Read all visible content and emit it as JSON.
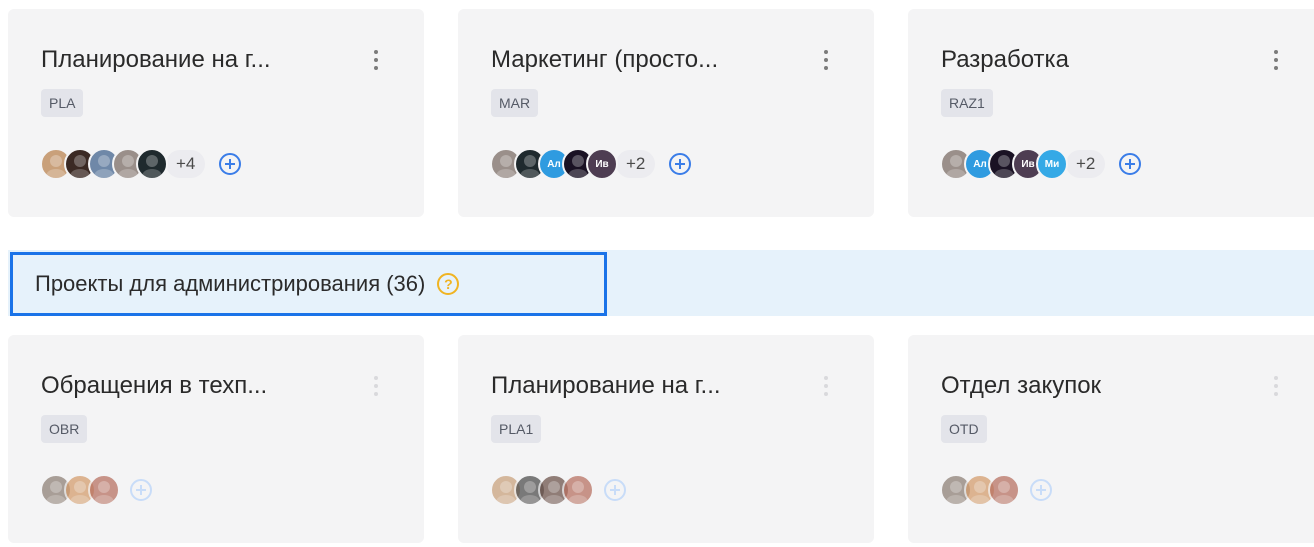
{
  "projects_top": [
    {
      "title": "Планирование на г...",
      "key": "PLA",
      "avatars": [
        {
          "initials": "",
          "color": "#c9a07a",
          "icon": "person-photo"
        },
        {
          "initials": "",
          "color": "#3b2a24",
          "icon": "person-photo"
        },
        {
          "initials": "",
          "color": "#6f88a8",
          "icon": "person-photo"
        },
        {
          "initials": "",
          "color": "#9a8f8a",
          "icon": "person-photo"
        },
        {
          "initials": "",
          "color": "#1f2a2e",
          "icon": "person-photo"
        }
      ],
      "more": "+4"
    },
    {
      "title": "Маркетинг (просто...",
      "key": "MAR",
      "avatars": [
        {
          "initials": "",
          "color": "#9a8f8a",
          "icon": "person-photo"
        },
        {
          "initials": "",
          "color": "#1f2a2e",
          "icon": "person-photo"
        },
        {
          "initials": "Ал",
          "color": "#2f9be0",
          "icon": "initials"
        },
        {
          "initials": "",
          "color": "#1a1224",
          "icon": "person-photo"
        },
        {
          "initials": "Ив",
          "color": "#4e3d52",
          "icon": "initials"
        }
      ],
      "more": "+2"
    },
    {
      "title": "Разработка",
      "key": "RAZ1",
      "avatars": [
        {
          "initials": "",
          "color": "#9a8f8a",
          "icon": "person-photo"
        },
        {
          "initials": "Ал",
          "color": "#2f9be0",
          "icon": "initials"
        },
        {
          "initials": "",
          "color": "#1a1224",
          "icon": "person-photo"
        },
        {
          "initials": "Ив",
          "color": "#4e3d52",
          "icon": "initials"
        },
        {
          "initials": "Ми",
          "color": "#35a9e6",
          "icon": "initials"
        }
      ],
      "more": "+2"
    }
  ],
  "section": {
    "title": "Проекты для администрирования (36)",
    "help_icon": "question-circle-icon",
    "help_glyph": "?"
  },
  "projects_admin": [
    {
      "title": "Обращения в техп...",
      "key": "OBR",
      "avatars": [
        {
          "initials": "",
          "color": "#8c7d73",
          "icon": "person-photo"
        },
        {
          "initials": "",
          "color": "#d39b6a",
          "icon": "person-photo"
        },
        {
          "initials": "",
          "color": "#b76f5f",
          "icon": "person-photo"
        }
      ]
    },
    {
      "title": "Планирование на г...",
      "key": "PLA1",
      "avatars": [
        {
          "initials": "",
          "color": "#c9a07a",
          "icon": "person-photo"
        },
        {
          "initials": "",
          "color": "#4b4a4a",
          "icon": "person-photo"
        },
        {
          "initials": "",
          "color": "#6a5048",
          "icon": "person-photo"
        },
        {
          "initials": "",
          "color": "#b76f5f",
          "icon": "person-photo"
        }
      ]
    },
    {
      "title": "Отдел закупок",
      "key": "OTD",
      "avatars": [
        {
          "initials": "",
          "color": "#8c7d73",
          "icon": "person-photo"
        },
        {
          "initials": "",
          "color": "#d39b6a",
          "icon": "person-photo"
        },
        {
          "initials": "",
          "color": "#b76f5f",
          "icon": "person-photo"
        }
      ]
    }
  ],
  "colors": {
    "accent": "#1a73e8",
    "add_icon": "#3a7de8",
    "help_icon": "#f0b422",
    "section_bg": "#e6f2fb",
    "card_bg": "#f4f4f5"
  }
}
